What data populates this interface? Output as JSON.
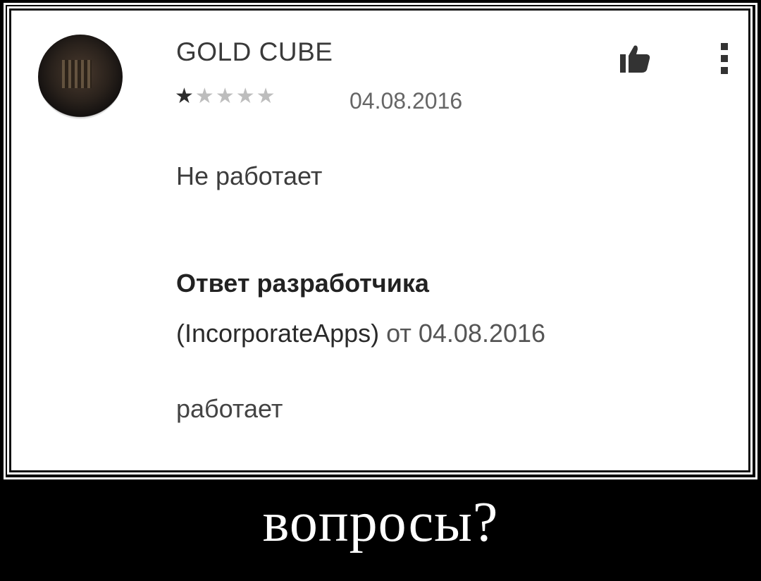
{
  "review": {
    "author": "GOLD CUBE",
    "rating": 1,
    "rating_max": 5,
    "stars": [
      "★",
      "★",
      "★",
      "★",
      "★"
    ],
    "date": "04.08.2016",
    "text": "Не работает"
  },
  "developer_reply": {
    "title": "Ответ разработчика",
    "developer": "(IncorporateApps)",
    "on_label": "от",
    "date": "04.08.2016",
    "text": "работает"
  },
  "caption": "вопросы?",
  "icons": {
    "like": "thumbs-up-icon",
    "more": "more-vert-icon",
    "avatar": "avatar-image"
  },
  "colors": {
    "background": "#000000",
    "panel": "#ffffff",
    "star_on": "#2c2c2c",
    "star_off": "#bdbdbd"
  }
}
